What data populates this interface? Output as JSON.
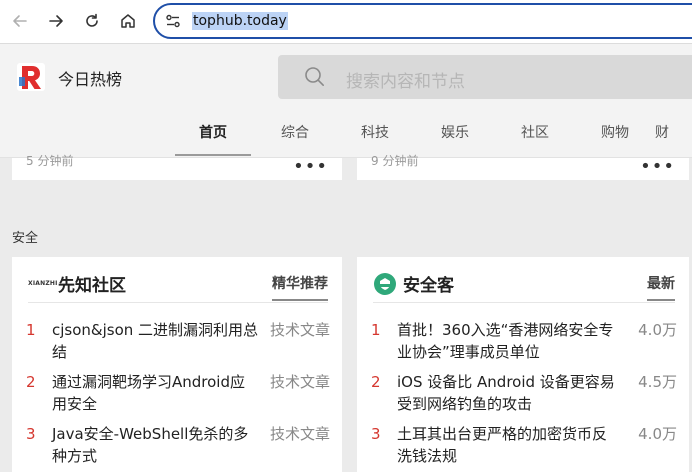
{
  "browser": {
    "url": "tophub.today"
  },
  "site": {
    "name": "今日热榜",
    "search_placeholder": "搜索内容和节点",
    "tabs": [
      "首页",
      "综合",
      "科技",
      "娱乐",
      "社区",
      "购物",
      "财"
    ]
  },
  "top_cards": {
    "left_time": "5 分钟前",
    "right_time": "9 分钟前",
    "more": "•••"
  },
  "section": {
    "title": "安全"
  },
  "left_card": {
    "brand": "先知社区",
    "brand_icon_text": "XIANZHI",
    "category": "精华推荐",
    "items": [
      {
        "idx": "1",
        "title_l1": "cjson&json 二进制漏洞利用总",
        "title_l2": "结",
        "meta": "技术文章"
      },
      {
        "idx": "2",
        "title_l1": "通过漏洞靶场学习Android应",
        "title_l2": "用安全",
        "meta": "技术文章"
      },
      {
        "idx": "3",
        "title_l1": "Java安全-WebShell免杀的多",
        "title_l2": "种方式",
        "meta": "技术文章"
      }
    ]
  },
  "right_card": {
    "brand": "安全客",
    "category": "最新",
    "items": [
      {
        "idx": "1",
        "title_l1": "首批！360入选“香港网络安全专",
        "title_l2": "业协会”理事成员单位",
        "meta": "4.0万"
      },
      {
        "idx": "2",
        "title_l1": "iOS 设备比 Android 设备更容易",
        "title_l2": "受到网络钓鱼的攻击",
        "meta": "4.5万"
      },
      {
        "idx": "3",
        "title_l1": "土耳其出台更严格的加密货币反",
        "title_l2": "洗钱法规",
        "meta": "4.0万"
      }
    ]
  },
  "colors": {
    "rank": "#d5372f",
    "url_border": "#1f4fa8",
    "logo_red": "#e02e2e"
  }
}
